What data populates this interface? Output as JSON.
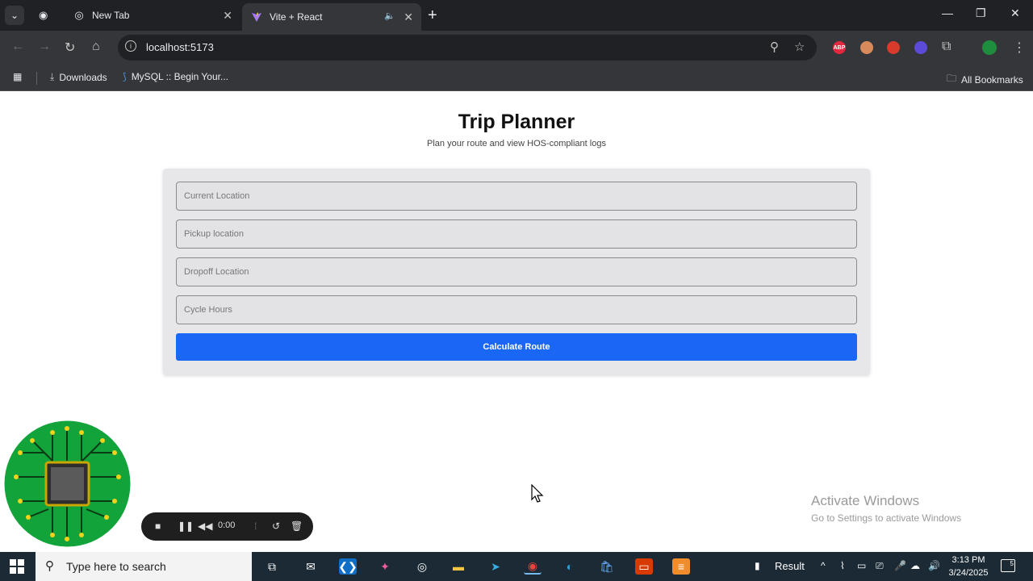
{
  "browser": {
    "tabs": [
      {
        "title": "New Tab",
        "icon": "chrome-icon"
      },
      {
        "title": "Vite + React",
        "icon": "vite-icon",
        "active": true
      }
    ],
    "url": "localhost:5173",
    "bookmarks": [
      {
        "label": "Downloads",
        "icon": "download-icon"
      },
      {
        "label": "MySQL :: Begin Your...",
        "icon": "mysql-icon"
      }
    ],
    "all_bookmarks": "All Bookmarks",
    "extensions": [
      {
        "name": "adblock",
        "label": "ABP",
        "color": "#e3283f"
      },
      {
        "name": "extension-2",
        "label": "",
        "color": "#d98a5a"
      },
      {
        "name": "extension-3",
        "label": "",
        "color": "#d83a2b"
      },
      {
        "name": "extension-4",
        "label": "",
        "color": "#5b4bd6"
      }
    ],
    "profile_color": "#1e8e3e"
  },
  "app": {
    "title": "Trip Planner",
    "subtitle": "Plan your route and view HOS-compliant logs",
    "fields": {
      "current_location": "Current Location",
      "pickup_location": "Pickup location",
      "dropoff_location": "Dropoff Location",
      "cycle_hours": "Cycle Hours"
    },
    "submit_label": "Calculate Route",
    "accent_color": "#1a66f5"
  },
  "recorder": {
    "time": "0:00"
  },
  "watermark": {
    "line1": "Activate Windows",
    "line2": "Go to Settings to activate Windows"
  },
  "taskbar": {
    "search_placeholder": "Type here to search",
    "apps": [
      "task-view",
      "mail",
      "vscode",
      "copilot",
      "obs",
      "file-explorer",
      "telegram",
      "chrome",
      "edge",
      "store",
      "office",
      "sublime"
    ],
    "tray_result": "Result",
    "time": "3:13 PM",
    "date": "3/24/2025",
    "notification_count": "5"
  }
}
